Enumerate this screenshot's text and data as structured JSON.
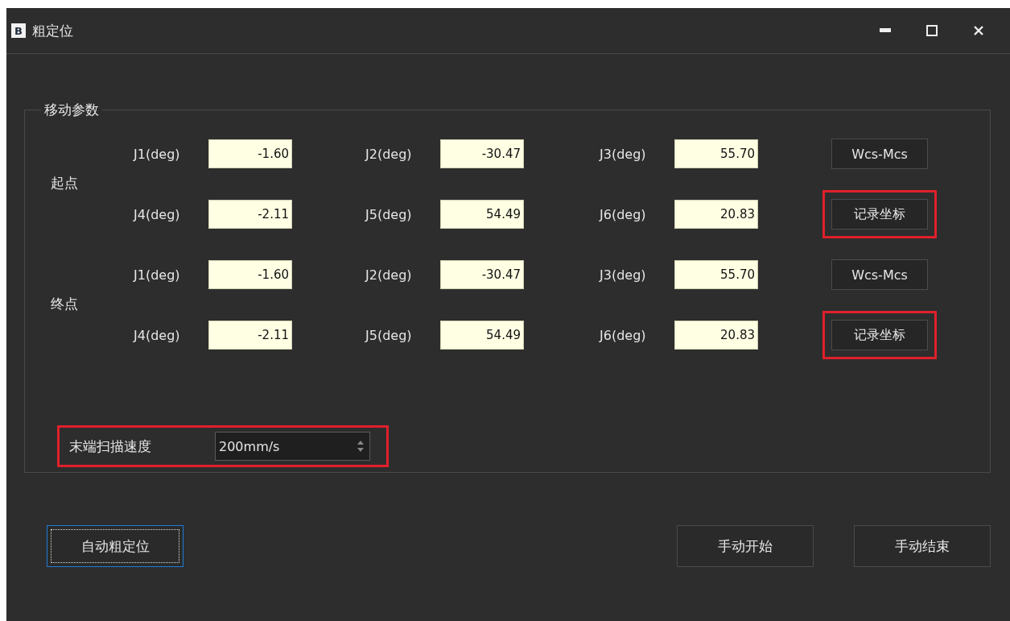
{
  "window": {
    "icon_text": "B",
    "title": "粗定位"
  },
  "group": {
    "title": "移动参数",
    "sections": [
      {
        "label": "起点",
        "rows": [
          {
            "fields": [
              {
                "label": "J1(deg)",
                "value": "-1.60"
              },
              {
                "label": "J2(deg)",
                "value": "-30.47"
              },
              {
                "label": "J3(deg)",
                "value": "55.70"
              }
            ],
            "button": {
              "label": "Wcs-Mcs",
              "highlighted": false
            }
          },
          {
            "fields": [
              {
                "label": "J4(deg)",
                "value": "-2.11"
              },
              {
                "label": "J5(deg)",
                "value": "54.49"
              },
              {
                "label": "J6(deg)",
                "value": "20.83"
              }
            ],
            "button": {
              "label": "记录坐标",
              "highlighted": true
            }
          }
        ]
      },
      {
        "label": "终点",
        "rows": [
          {
            "fields": [
              {
                "label": "J1(deg)",
                "value": "-1.60"
              },
              {
                "label": "J2(deg)",
                "value": "-30.47"
              },
              {
                "label": "J3(deg)",
                "value": "55.70"
              }
            ],
            "button": {
              "label": "Wcs-Mcs",
              "highlighted": false
            }
          },
          {
            "fields": [
              {
                "label": "J4(deg)",
                "value": "-2.11"
              },
              {
                "label": "J5(deg)",
                "value": "54.49"
              },
              {
                "label": "J6(deg)",
                "value": "20.83"
              }
            ],
            "button": {
              "label": "记录坐标",
              "highlighted": true
            }
          }
        ]
      }
    ],
    "speed": {
      "label": "末端扫描速度",
      "value": "200mm/s",
      "highlighted": true
    }
  },
  "buttons": [
    {
      "label": "自动粗定位",
      "focused": true
    },
    {
      "label": "手动开始",
      "focused": false
    },
    {
      "label": "手动结束",
      "focused": false
    }
  ]
}
